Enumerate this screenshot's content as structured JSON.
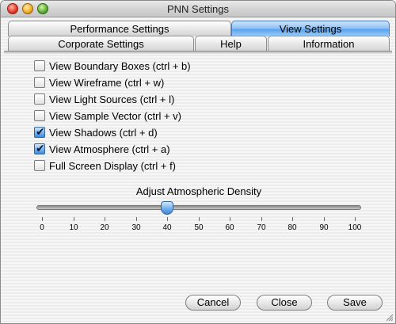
{
  "window": {
    "title": "PNN Settings"
  },
  "tabs": {
    "performance": "Performance Settings",
    "view": "View Settings",
    "corporate": "Corporate Settings",
    "help": "Help",
    "information": "Information",
    "selected": "View Settings"
  },
  "options": [
    {
      "label": "View Boundary Boxes (ctrl + b)",
      "checked": false
    },
    {
      "label": "View Wireframe (ctrl + w)",
      "checked": false
    },
    {
      "label": "View Light Sources (ctrl + l)",
      "checked": false
    },
    {
      "label": "View Sample Vector (ctrl + v)",
      "checked": false
    },
    {
      "label": "View Shadows (ctrl + d)",
      "checked": true
    },
    {
      "label": "View Atmosphere (ctrl + a)",
      "checked": true
    },
    {
      "label": "Full Screen Display (ctrl + f)",
      "checked": false
    }
  ],
  "slider": {
    "title": "Adjust Atmospheric Density",
    "value": 40,
    "min": 0,
    "max": 100,
    "tick_labels": [
      "0",
      "10",
      "20",
      "30",
      "40",
      "50",
      "60",
      "70",
      "80",
      "90",
      "100"
    ]
  },
  "buttons": {
    "cancel": "Cancel",
    "close": "Close",
    "save": "Save"
  },
  "colors": {
    "accent": "#5aa3ee",
    "checked": "#3e8ae2"
  }
}
